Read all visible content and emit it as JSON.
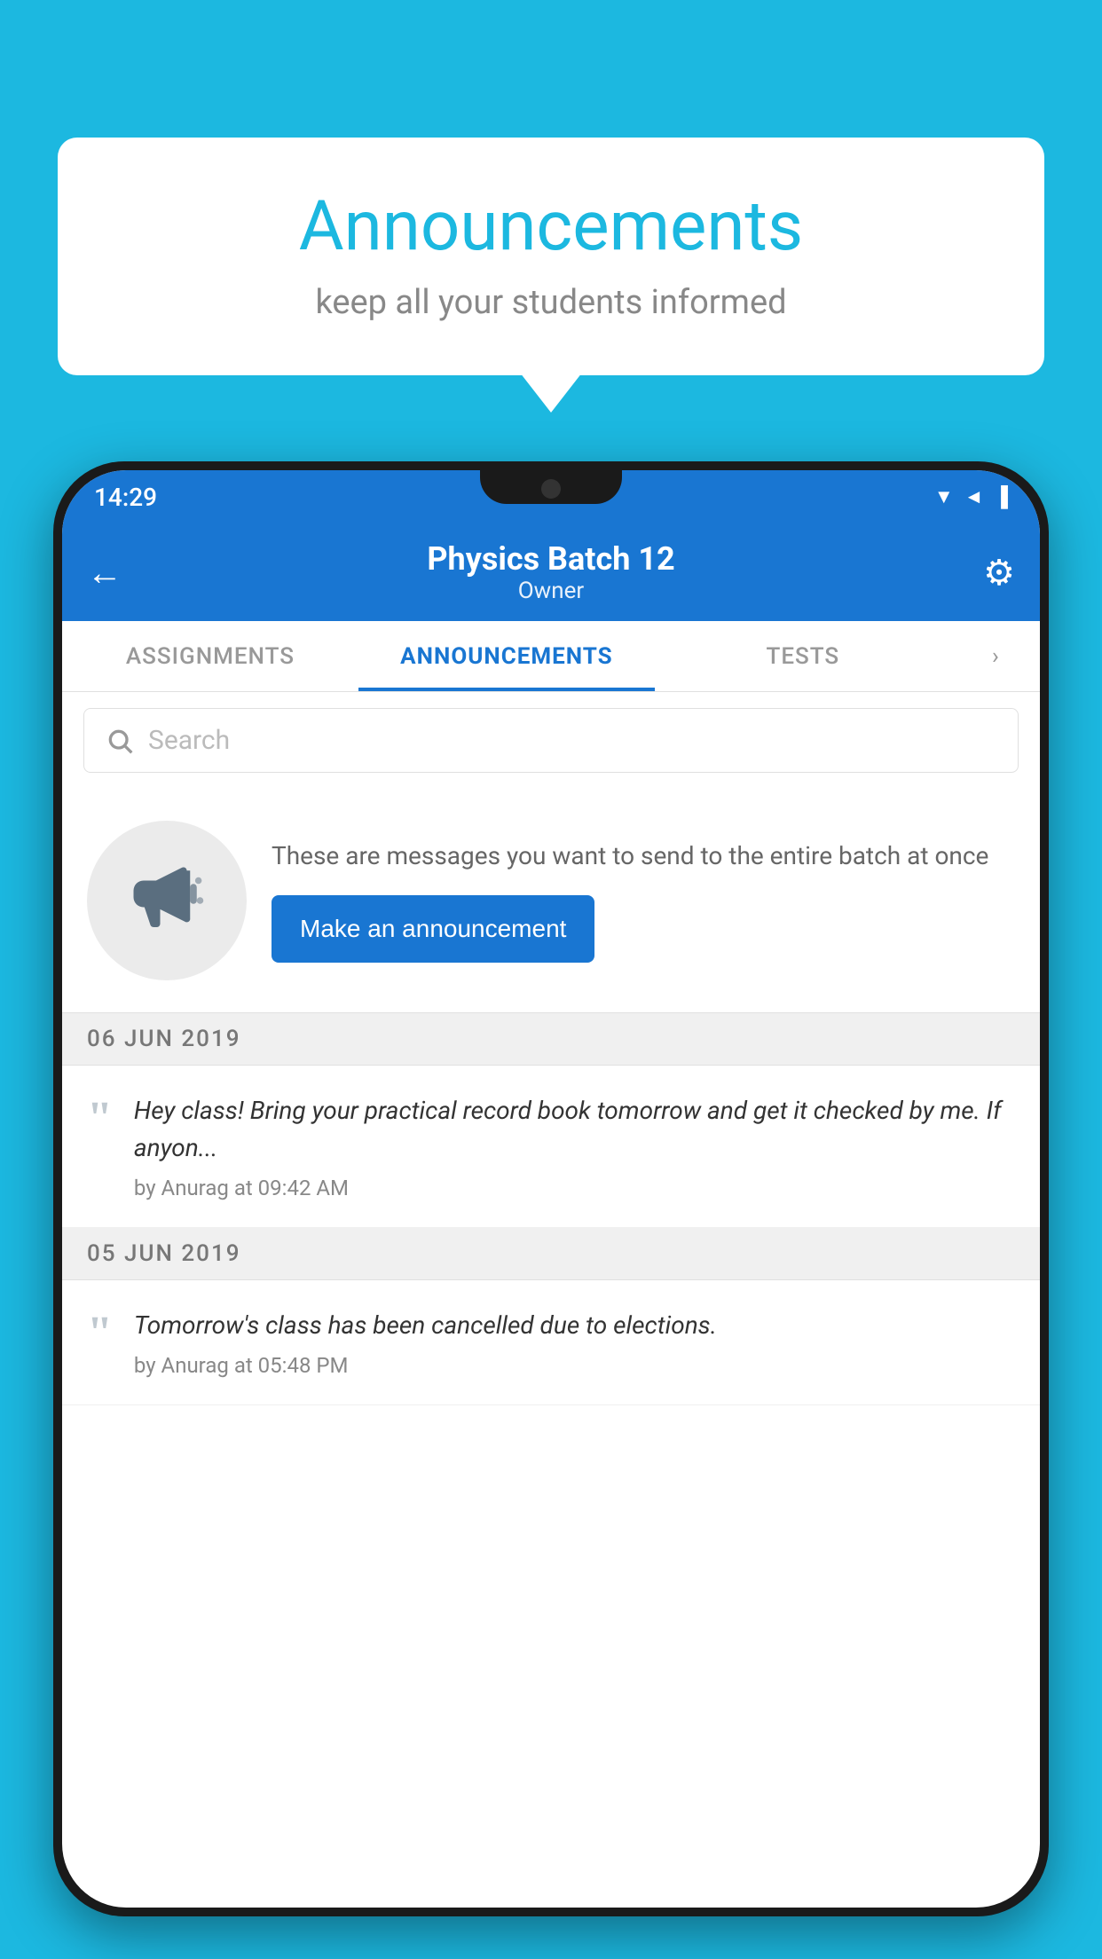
{
  "background_color": "#1cb8e0",
  "speech_bubble": {
    "title": "Announcements",
    "subtitle": "keep all your students informed"
  },
  "phone": {
    "status_bar": {
      "time": "14:29",
      "icons": "▼◄▐"
    },
    "app_bar": {
      "title": "Physics Batch 12",
      "subtitle": "Owner",
      "back_label": "←",
      "gear_label": "⚙"
    },
    "tabs": [
      {
        "label": "ASSIGNMENTS",
        "active": false
      },
      {
        "label": "ANNOUNCEMENTS",
        "active": true
      },
      {
        "label": "TESTS",
        "active": false
      }
    ],
    "search": {
      "placeholder": "Search"
    },
    "empty_state": {
      "description": "These are messages you want to send to the entire batch at once",
      "button_label": "Make an announcement"
    },
    "announcements": [
      {
        "date": "06  JUN  2019",
        "message": "Hey class! Bring your practical record book tomorrow and get it checked by me. If anyon...",
        "meta": "by Anurag at 09:42 AM"
      },
      {
        "date": "05  JUN  2019",
        "message": "Tomorrow's class has been cancelled due to elections.",
        "meta": "by Anurag at 05:48 PM"
      }
    ]
  }
}
